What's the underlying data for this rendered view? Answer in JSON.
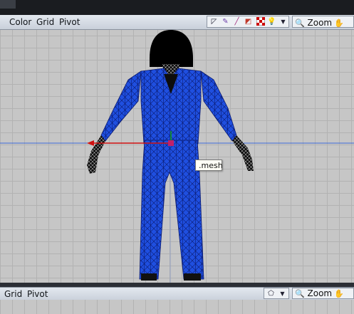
{
  "menu": {
    "items": [
      "Color",
      "Grid",
      "Pivot"
    ]
  },
  "toolbar": {
    "zoom_label": "Zoom",
    "pan_label": "Pa"
  },
  "viewport": {
    "tooltip": ".mesh"
  },
  "bottom_panel": {
    "menu": {
      "items": [
        "Grid",
        "Pivot"
      ]
    },
    "zoom_label": "Zoom",
    "pan_label": "Pa"
  },
  "icons": [
    "select-icon",
    "edit-icon",
    "paint-icon",
    "palette-icon",
    "checker-icon",
    "bulb-icon",
    "dropdown-icon",
    "magnifier-icon",
    "hand-icon"
  ]
}
